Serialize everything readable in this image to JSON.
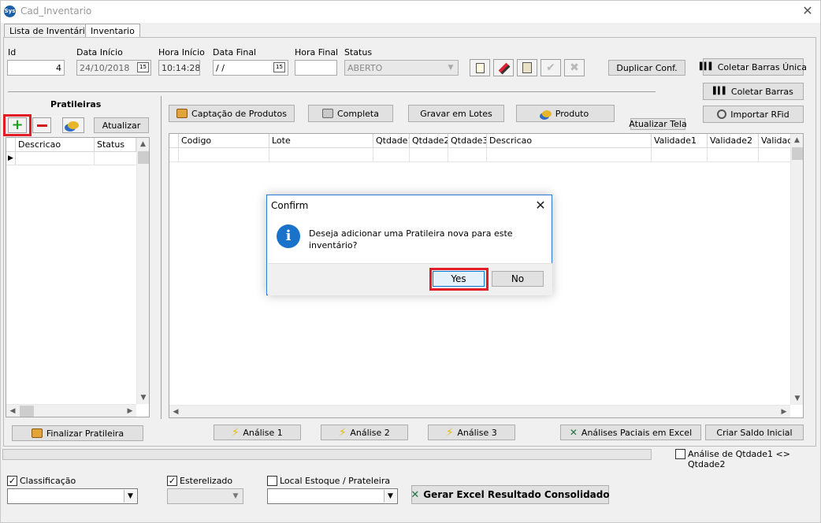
{
  "window": {
    "title": "Cad_Inventario",
    "app_icon_text": "Sys"
  },
  "tabs": [
    {
      "label": "Lista de Inventários",
      "active": false
    },
    {
      "label": "Inventario",
      "active": true
    }
  ],
  "header_fields": {
    "id": {
      "label": "Id",
      "value": "4"
    },
    "data_inicio": {
      "label": "Data Início",
      "value": "24/10/2018",
      "calendar_text": "15"
    },
    "hora_inicio": {
      "label": "Hora Início",
      "value": "10:14:28"
    },
    "data_final": {
      "label": "Data Final",
      "value": " / /",
      "calendar_text": "15"
    },
    "hora_final": {
      "label": "Hora Final",
      "value": ""
    },
    "status": {
      "label": "Status",
      "value": "ABERTO"
    }
  },
  "toolbar_icons": [
    "new-document-icon",
    "edit-icon",
    "clipboard-icon",
    "check-icon",
    "cancel-icon"
  ],
  "right_buttons": {
    "duplicar": "Duplicar Conf.",
    "coletar_unica": "Coletar Barras Única",
    "coletar": "Coletar Barras",
    "importar_rfid": "Importar RFid"
  },
  "prateleiras": {
    "title": "Pratileiras",
    "atualizar": "Atualizar",
    "columns": [
      "Descricao",
      "Status"
    ]
  },
  "action_buttons": {
    "captacao": "Captação de Produtos",
    "completa": "Completa",
    "gravar_lotes": "Gravar em Lotes",
    "produto": "Produto",
    "atualizar_tela": "Atualizar Tela"
  },
  "products_grid": {
    "columns": [
      "Codigo",
      "Lote",
      "Qtdade1",
      "Qtdade2",
      "Qtdade3",
      "Descricao",
      "Validade1",
      "Validade2",
      "Validad"
    ]
  },
  "bottom_buttons": {
    "finalizar": "Finalizar Pratileira",
    "analise1": "Análise 1",
    "analise2": "Análise 2",
    "analise3": "Análise 3",
    "analises_excel": "Análises Paciais em Excel",
    "criar_saldo": "Criar Saldo Inicial"
  },
  "analise_check": {
    "label": "Análise de Qtdade1 <> Qtdade2",
    "checked": false
  },
  "footer": {
    "classificacao": {
      "label": "Classificação",
      "checked": true
    },
    "esterelizado": {
      "label": "Esterelizado",
      "checked": true
    },
    "local_estoque": {
      "label": "Local Estoque / Prateleira",
      "checked": false
    },
    "gerar_excel": "Gerar Excel Resultado Consolidado"
  },
  "dialog": {
    "title": "Confirm",
    "message": "Deseja adicionar uma Pratileira nova para este inventário?",
    "yes": "Yes",
    "no": "No"
  },
  "colors": {
    "highlight": "#e21b25",
    "info_blue": "#1a73c9",
    "dialog_border": "#2b79d8"
  }
}
